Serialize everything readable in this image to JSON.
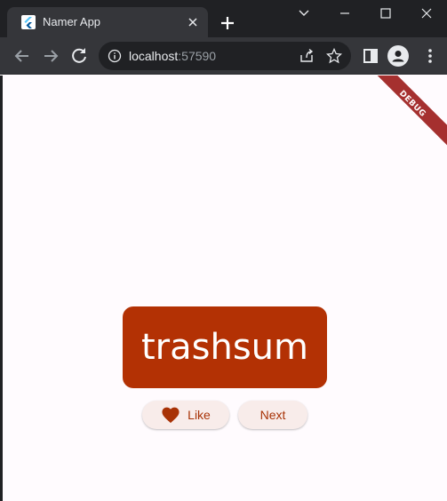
{
  "browser": {
    "tab_title": "Namer App",
    "url_host": "localhost",
    "url_port": ":57590"
  },
  "app": {
    "debug_label": "DEBUG",
    "current_word": "trashsum",
    "like_label": "Like",
    "next_label": "Next"
  },
  "colors": {
    "primary": "#b33104",
    "button_background": "#f8ecea",
    "page_background": "#fffbfe",
    "debug_banner": "#a5302f"
  },
  "icons": [
    "flutter-favicon-icon",
    "close-icon",
    "plus-icon",
    "chevron-down-icon",
    "minimize-icon",
    "maximize-icon",
    "back-arrow-icon",
    "forward-arrow-icon",
    "reload-icon",
    "info-icon",
    "share-icon",
    "star-icon",
    "side-panel-icon",
    "profile-icon",
    "kebab-menu-icon",
    "heart-icon"
  ]
}
